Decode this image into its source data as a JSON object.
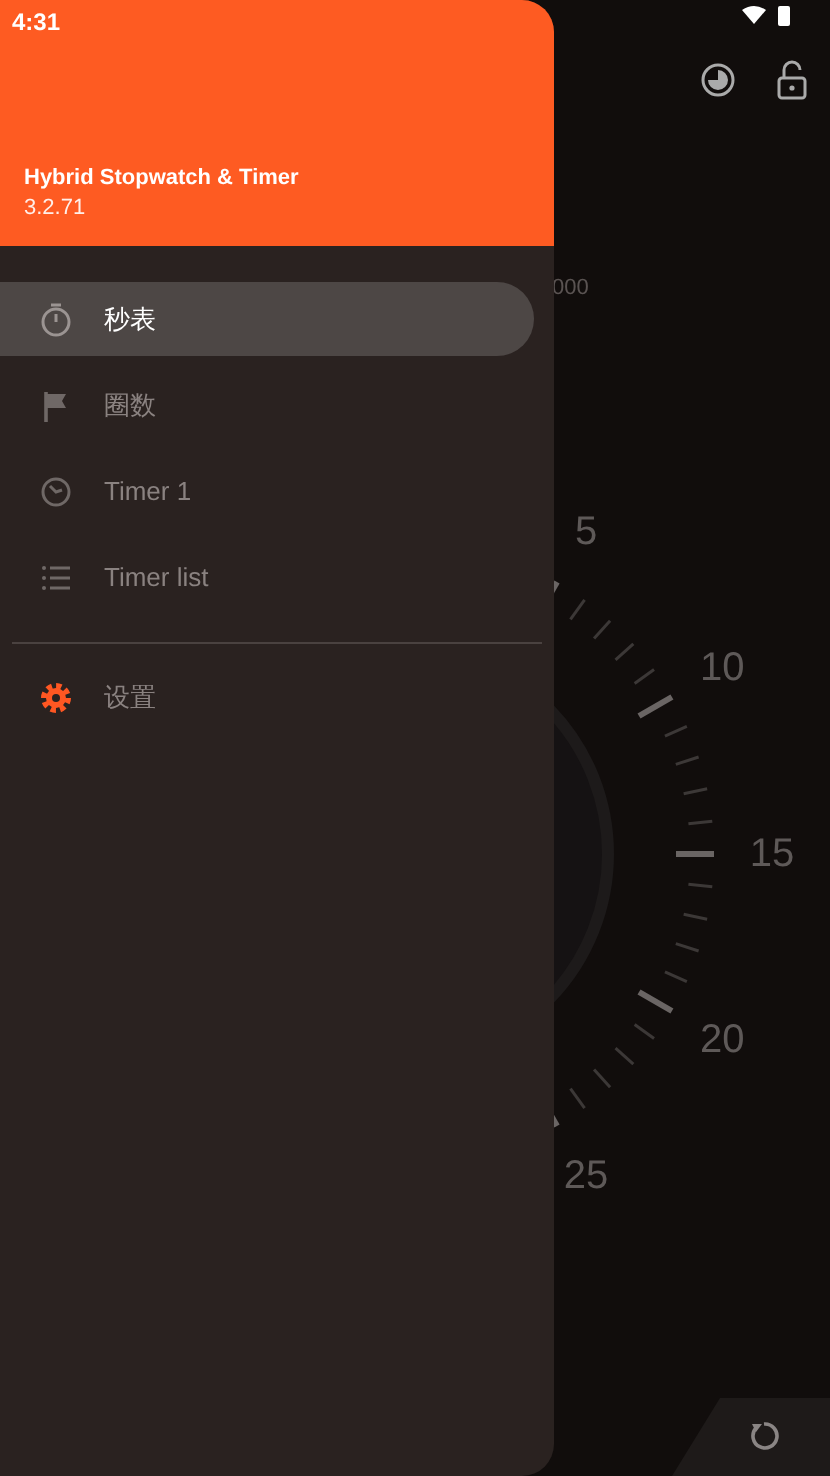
{
  "status_bar": {
    "time": "4:31"
  },
  "dial": {
    "caption": "000",
    "labels": [
      "5",
      "10",
      "15",
      "20",
      "25"
    ]
  },
  "drawer": {
    "app_name": "Hybrid Stopwatch & Timer",
    "version": "3.2.71",
    "items": [
      {
        "kind": "stopwatch",
        "label": "秒表",
        "selected": true
      },
      {
        "kind": "laps",
        "label": "圈数",
        "selected": false
      },
      {
        "kind": "timer",
        "label": "Timer 1",
        "selected": false
      },
      {
        "kind": "list",
        "label": "Timer list",
        "selected": false
      },
      {
        "kind": "divider"
      },
      {
        "kind": "settings",
        "label": "设置",
        "selected": false
      }
    ]
  }
}
